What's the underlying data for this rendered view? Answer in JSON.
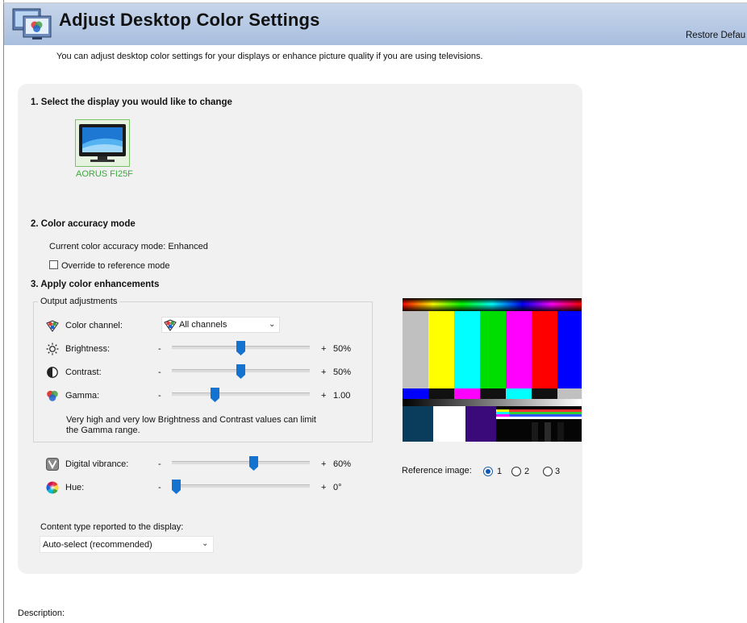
{
  "header": {
    "title": "Adjust Desktop Color Settings",
    "restore_link": "Restore Defau",
    "icon": "display-color-settings-icon"
  },
  "intro": "You can adjust desktop color settings for your displays or enhance picture quality if you are using televisions.",
  "section1": {
    "title": "1. Select the display you would like to change",
    "display_name": "AORUS FI25F",
    "display_icon": "monitor-icon"
  },
  "section2": {
    "title": "2. Color accuracy mode",
    "current_mode": "Current color accuracy mode: Enhanced",
    "override_label": "Override to reference mode",
    "override_checked": false
  },
  "section3": {
    "title": "3. Apply color enhancements",
    "group_label": "Output adjustments",
    "color_channel": {
      "label": "Color channel:",
      "selected": "All channels"
    },
    "brightness": {
      "label": "Brightness:",
      "minus": "-",
      "plus": "+",
      "value": "50%",
      "level": 0.5
    },
    "contrast": {
      "label": "Contrast:",
      "minus": "-",
      "plus": "+",
      "value": "50%",
      "level": 0.5
    },
    "gamma": {
      "label": "Gamma:",
      "minus": "-",
      "plus": "+",
      "value": "1.00",
      "level": 0.3
    },
    "note_line1": "Very high and very low Brightness and Contrast values can limit",
    "note_line2": "the Gamma range.",
    "vibrance": {
      "label": "Digital vibrance:",
      "minus": "-",
      "plus": "+",
      "value": "60%",
      "level": 0.6
    },
    "hue": {
      "label": "Hue:",
      "minus": "-",
      "plus": "+",
      "value": "0°",
      "level": 0.0
    }
  },
  "content_type": {
    "label": "Content type reported to the display:",
    "selected": "Auto-select (recommended)"
  },
  "reference_image": {
    "label": "Reference image:",
    "options": [
      "1",
      "2",
      "3"
    ],
    "selected": "1"
  },
  "description_label": "Description:",
  "colors": {
    "header_gradient_top": "#c7d5ea",
    "header_gradient_bottom": "#a9bfdf",
    "panel_bg": "#f1f1f1",
    "slider_thumb": "#1473d0",
    "display_name": "#3ea83e"
  }
}
